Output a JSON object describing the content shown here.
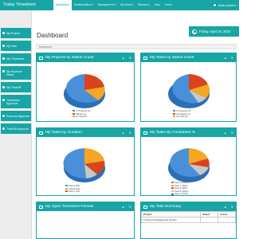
{
  "app": {
    "title": "Today Timesheet"
  },
  "nav": [
    "Dashboard",
    "Administration ▾",
    "Management ▾",
    "My Work ▾",
    "Reports ▾",
    "Help",
    "Users"
  ],
  "user": {
    "name": "Moritz Admin ▾"
  },
  "sidebar": [
    {
      "label": "My Project"
    },
    {
      "label": "My Task"
    },
    {
      "label": "My Timesheet"
    },
    {
      "label": "My Expense Sheet"
    },
    {
      "label": "My TimeOff"
    },
    {
      "label": "Timesheet Approval"
    },
    {
      "label": "Expense Approval"
    },
    {
      "label": "TimeOff Approval"
    }
  ],
  "page": {
    "title": "Dashboard",
    "date": "Friday, April 10, 2015",
    "breadcrumb": "Dashboard",
    "breadcrumb_end": "›"
  },
  "panels": {
    "projects_status": {
      "title": "My Projects by Status Count",
      "legend": [
        "In Progress (4)",
        "Started (1)",
        "On Hold (1)"
      ]
    },
    "tasks_status": {
      "title": "My Tasks by Status Count",
      "legend": [
        "In Progress (5)",
        "Completed (1)",
        "On Hold (2)",
        "Started (1)"
      ]
    },
    "tasks_duration": {
      "title": "My Tasks by Duration",
      "legend": [
        "Task A (30)",
        "Task B (18)",
        "Task C (12)",
        "Task D (8)"
      ]
    },
    "tasks_completed": {
      "title": "My Tasks By Completed %",
      "legend": [
        "Task X (25%)",
        "Task Y (50%)",
        "Task Z (40%)",
        "Task W (60%)",
        "Task V (10%)"
      ]
    },
    "open_periods": {
      "title": "My Open Timesheet Periods"
    },
    "task_summary": {
      "title": "My Task Summary",
      "headers": [
        "Project",
        "Status",
        "Count"
      ],
      "rows": [
        [
          "Transport Management System",
          "",
          ""
        ]
      ]
    }
  },
  "controls": {
    "collapse": "▴",
    "close": "✕"
  },
  "colors": {
    "accent": "#17a5a5",
    "blue": "#4a90d9",
    "orange": "#f5a623",
    "red": "#d9441c",
    "gray": "#d0d0d0"
  }
}
